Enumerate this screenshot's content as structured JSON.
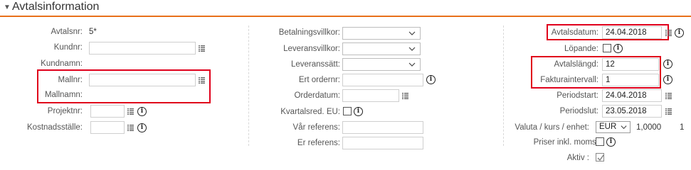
{
  "section": {
    "title": "Avtalsinformation"
  },
  "col1": {
    "avtalsnr_label": "Avtalsnr:",
    "avtalsnr_value": "5*",
    "kundnr_label": "Kundnr:",
    "kundnamn_label": "Kundnamn:",
    "mallnr_label": "Mallnr:",
    "mallnamn_label": "Mallnamn:",
    "projektnr_label": "Projektnr:",
    "kostnadsstalle_label": "Kostnadsställe:"
  },
  "col2": {
    "betalningsvillkor_label": "Betalningsvillkor:",
    "leveransvillkor_label": "Leveransvillkor:",
    "leveranssatt_label": "Leveranssätt:",
    "ert_ordernr_label": "Ert ordernr:",
    "orderdatum_label": "Orderdatum:",
    "kvartalsred_label": "Kvartalsred. EU:",
    "var_referens_label": "Vår referens:",
    "er_referens_label": "Er referens:"
  },
  "col3": {
    "avtalsdatum_label": "Avtalsdatum:",
    "avtalsdatum_value": "24.04.2018",
    "lopande_label": "Löpande:",
    "avtalslangd_label": "Avtalslängd:",
    "avtalslangd_value": "12",
    "fakturaintervall_label": "Fakturaintervall:",
    "fakturaintervall_value": "1",
    "periodstart_label": "Periodstart:",
    "periodstart_value": "24.04.2018",
    "periodslut_label": "Periodslut:",
    "periodslut_value": "23.05.2018",
    "valuta_label": "Valuta / kurs / enhet:",
    "valuta_value": "EUR",
    "kurs_value": "1,0000",
    "enhet_value": "1",
    "priser_label": "Priser inkl. moms:",
    "aktiv_label": "Aktiv :",
    "aktiv_checked": true,
    "lopande_checked": false,
    "priser_checked": false,
    "kvartalsred_checked": false
  },
  "colors": {
    "accent": "#e8701a",
    "highlight": "#e0001b"
  },
  "icons": [
    "collapse-triangle-icon",
    "list-icon",
    "info-icon",
    "chevron-down-icon",
    "checkmark-icon"
  ]
}
